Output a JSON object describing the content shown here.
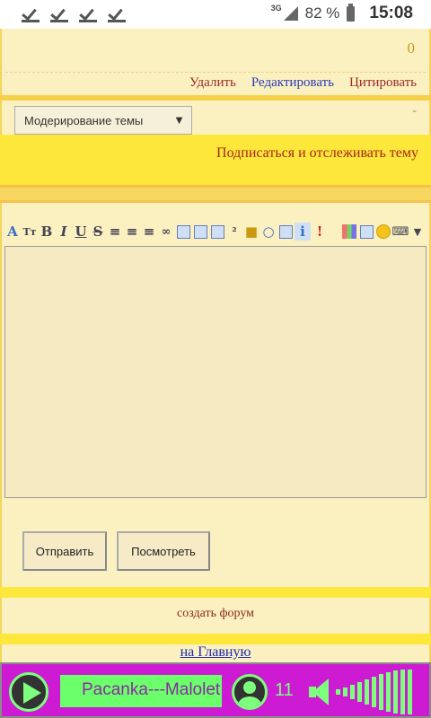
{
  "status_bar": {
    "network": "3G",
    "battery": "82 %",
    "time": "15:08",
    "icons": [
      "check-icon",
      "check-icon",
      "check-icon",
      "check-icon",
      "signal-icon",
      "battery-icon"
    ]
  },
  "post": {
    "count": "0",
    "actions": {
      "delete": "Удалить",
      "edit": "Редактировать",
      "quote": "Цитировать"
    }
  },
  "moderation": {
    "select_value": "Модерирование темы",
    "dash": "-"
  },
  "subscribe": "Подписаться и отслеживать тему",
  "editor": {
    "toolbar_icons": [
      "font-icon",
      "font-size-icon",
      "bold-icon",
      "italic-icon",
      "underline-icon",
      "strike-icon",
      "align-left-icon",
      "align-center-icon",
      "align-right-icon",
      "link-icon",
      "image-icon",
      "copy-icon",
      "paste-icon",
      "sup-icon",
      "lock-icon",
      "speech-icon",
      "refresh-icon",
      "info-icon",
      "alert-icon",
      "color-grid-icon",
      "table-icon",
      "smiley-icon",
      "keyboard-icon",
      "dropdown-icon"
    ],
    "submit_label": "Отправить",
    "preview_label": "Посмотреть"
  },
  "footer": {
    "create_forum": "создать форум",
    "home_link": "на Главную"
  },
  "player": {
    "track": "Pacanka---Malolet",
    "listeners": "11",
    "colors": {
      "bg": "#cc1bd2",
      "accent": "#7dff7d"
    }
  }
}
